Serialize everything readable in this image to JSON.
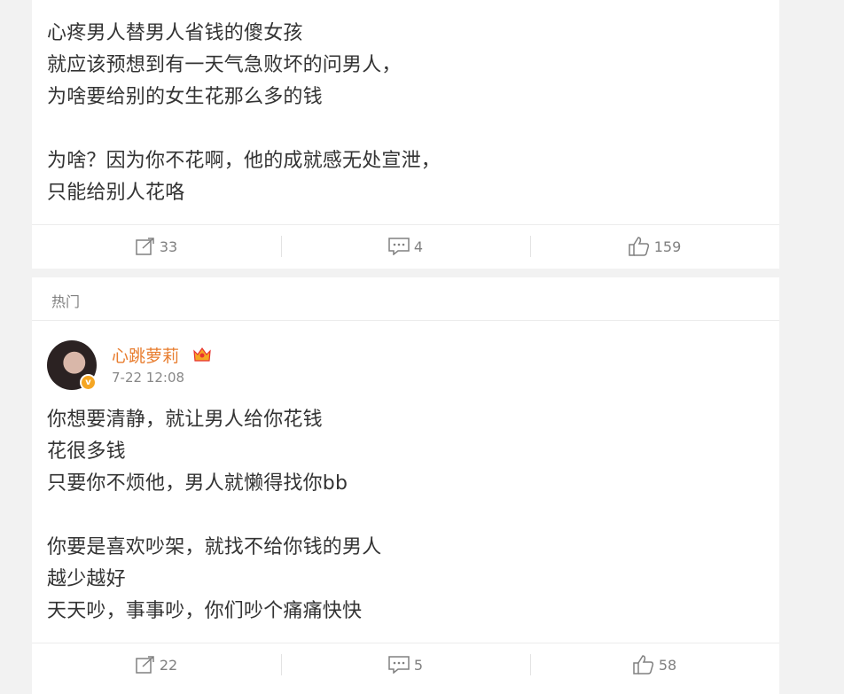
{
  "post1": {
    "lines": [
      "心疼男人替男人省钱的傻女孩",
      "就应该预想到有一天气急败坏的问男人，",
      "为啥要给别的女生花那么多的钱",
      "",
      "为啥？因为你不花啊，他的成就感无处宣泄，",
      "只能给别人花咯"
    ],
    "repost_count": "33",
    "comment_count": "4",
    "like_count": "159"
  },
  "post2": {
    "section_label": "热门",
    "username": "心跳萝莉",
    "timestamp": "7-22 12:08",
    "verified_mark": "v",
    "lines": [
      "你想要清静，就让男人给你花钱",
      "花很多钱",
      "只要你不烦他，男人就懒得找你bb",
      "",
      "你要是喜欢吵架，就找不给你钱的男人",
      "越少越好",
      "天天吵，事事吵，你们吵个痛痛快快"
    ],
    "repost_count": "22",
    "comment_count": "5",
    "like_count": "58"
  },
  "colors": {
    "username": "#e87d2f",
    "badge": "#f5a623",
    "muted": "#808080"
  },
  "icons": [
    "repost-icon",
    "comment-icon",
    "like-icon",
    "crown-icon",
    "verified-badge-icon"
  ]
}
